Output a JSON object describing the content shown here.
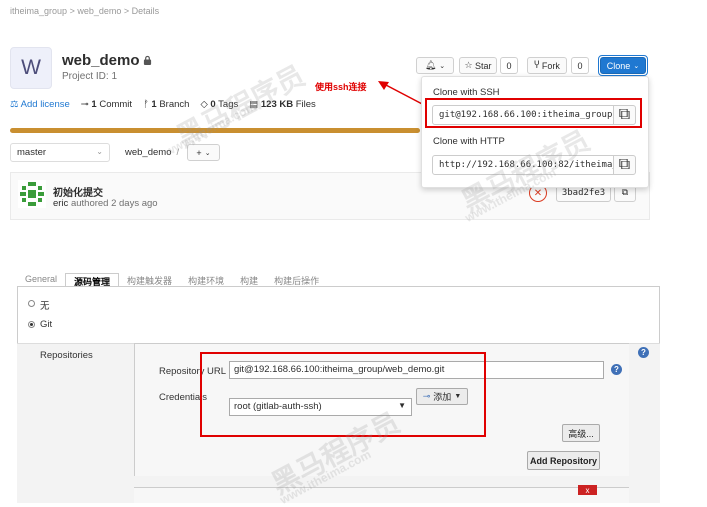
{
  "gitlab": {
    "breadcrumb": [
      "itheima_group",
      "web_demo",
      "Details"
    ],
    "project": {
      "avatar_letter": "W",
      "name": "web_demo",
      "id_text": "Project ID: 1"
    },
    "buttons": {
      "star": "Star",
      "star_count": "0",
      "fork": "Fork",
      "fork_count": "0",
      "clone": "Clone"
    },
    "annotation": "使用ssh连接",
    "stats": {
      "license": "Add license",
      "commits_num": "1",
      "commits_label": "Commit",
      "branches_num": "1",
      "branches_label": "Branch",
      "tags_num": "0",
      "tags_label": "Tags",
      "files_num": "123 KB",
      "files_label": "Files"
    },
    "branch_select": "master",
    "path": {
      "repo": "web_demo",
      "separator": "/",
      "add": "+"
    },
    "commit": {
      "title": "初始化提交",
      "author": "eric",
      "time": "authored 2 days ago",
      "sha": "3bad2fe3"
    },
    "clone_dropdown": {
      "ssh_label": "Clone with SSH",
      "ssh_url": "git@192.168.66.100:itheima_group/web_demo.git",
      "http_label": "Clone with HTTP",
      "http_url": "http://192.168.66.100:82/itheima_group/web_demo.git"
    }
  },
  "jenkins": {
    "tabs": [
      "General",
      "源码管理",
      "构建触发器",
      "构建环境",
      "构建",
      "构建后操作"
    ],
    "active_tab": 1,
    "scm_options": {
      "none": "无",
      "git": "Git"
    },
    "repositories_label": "Repositories",
    "repo_url_label": "Repository URL",
    "repo_url_value": "git@192.168.66.100:itheima_group/web_demo.git",
    "credentials_label": "Credentials",
    "credentials_value": "root (gitlab-auth-ssh)",
    "add_button": "添加",
    "advanced_button": "高级...",
    "add_repository_button": "Add Repository",
    "delete_symbol": "x",
    "help_symbol": "?"
  },
  "watermark": {
    "text": "黑马程序员",
    "url": "www.itheima.com"
  },
  "colors": {
    "accent_blue": "#1f78d1",
    "highlight_red": "#e00000",
    "language_bar": "#c98f30",
    "jenkins_help": "#3f70b7"
  }
}
